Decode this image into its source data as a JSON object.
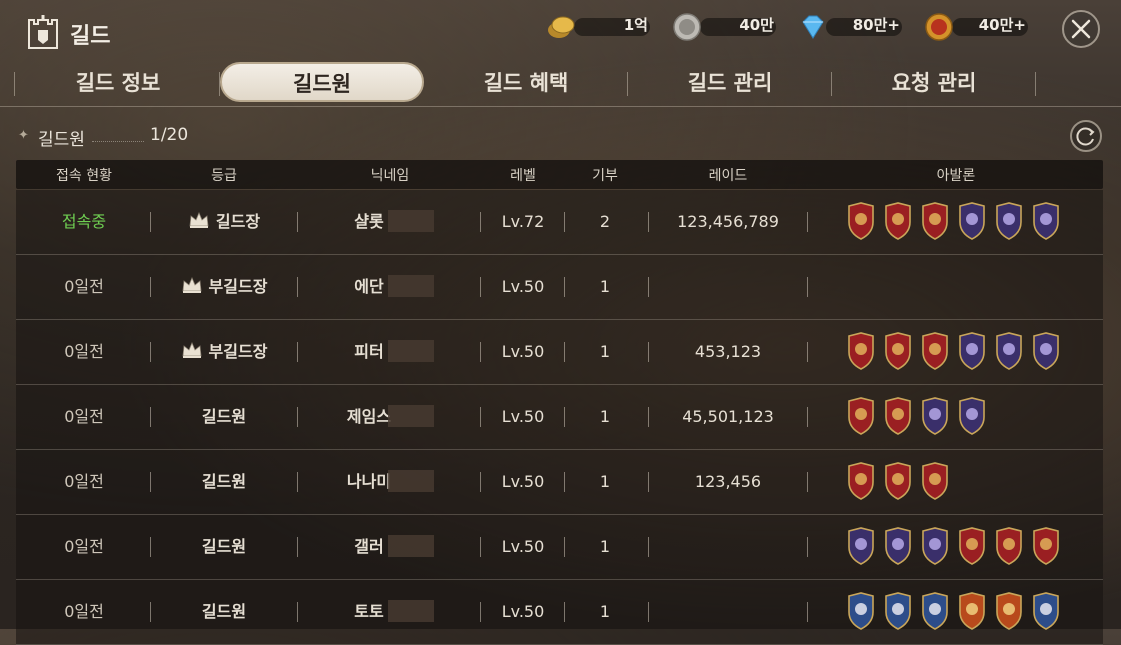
{
  "header": {
    "title": "길드",
    "currencies": [
      {
        "icon": "gold-coin-icon",
        "value": "1억"
      },
      {
        "icon": "silver-coin-icon",
        "value": "40만"
      },
      {
        "icon": "diamond-icon",
        "value": "80만+"
      },
      {
        "icon": "crest-coin-icon",
        "value": "40만+"
      }
    ]
  },
  "tabs": [
    "길드 정보",
    "길드원",
    "길드 혜택",
    "길드 관리",
    "요청 관리"
  ],
  "active_tab": "길드원",
  "member_count": {
    "label": "길드원",
    "value": "1/20"
  },
  "columns": [
    "접속 현황",
    "등급",
    "닉네임",
    "레벨",
    "기부",
    "레이드",
    "아발론"
  ],
  "rows": [
    {
      "status": "접속중",
      "online": true,
      "grade": "길드장",
      "crown": true,
      "name": "샬롯",
      "level": "Lv.72",
      "donation": "2",
      "raid": "123,456,789",
      "badges": [
        "red",
        "red",
        "red",
        "purple",
        "purple",
        "purple"
      ]
    },
    {
      "status": "0일전",
      "online": false,
      "grade": "부길드장",
      "crown": true,
      "name": "에단",
      "level": "Lv.50",
      "donation": "1",
      "raid": "",
      "badges": []
    },
    {
      "status": "0일전",
      "online": false,
      "grade": "부길드장",
      "crown": true,
      "name": "피터",
      "level": "Lv.50",
      "donation": "1",
      "raid": "453,123",
      "badges": [
        "red",
        "red",
        "red",
        "purple",
        "purple",
        "purple"
      ]
    },
    {
      "status": "0일전",
      "online": false,
      "grade": "길드원",
      "crown": false,
      "name": "제임스",
      "level": "Lv.50",
      "donation": "1",
      "raid": "45,501,123",
      "badges": [
        "red",
        "red",
        "purple",
        "purple"
      ]
    },
    {
      "status": "0일전",
      "online": false,
      "grade": "길드원",
      "crown": false,
      "name": "나나미",
      "level": "Lv.50",
      "donation": "1",
      "raid": "123,456",
      "badges": [
        "red",
        "red",
        "red"
      ]
    },
    {
      "status": "0일전",
      "online": false,
      "grade": "길드원",
      "crown": false,
      "name": "갤러",
      "level": "Lv.50",
      "donation": "1",
      "raid": "",
      "badges": [
        "purple",
        "purple",
        "purple",
        "red",
        "red",
        "red"
      ]
    },
    {
      "status": "0일전",
      "online": false,
      "grade": "길드원",
      "crown": false,
      "name": "토토",
      "level": "Lv.50",
      "donation": "1",
      "raid": "",
      "badges": [
        "blue",
        "blue",
        "blue",
        "orange",
        "orange",
        "blue"
      ]
    }
  ]
}
